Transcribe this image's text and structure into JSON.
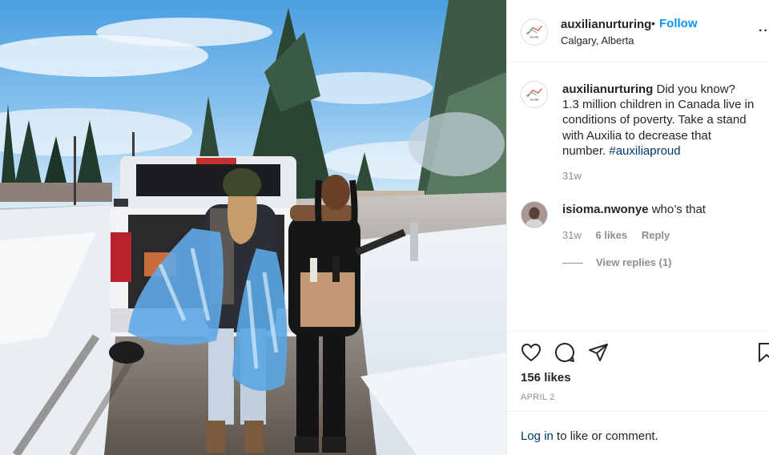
{
  "post": {
    "username": "auxilianurturing",
    "dot": "•",
    "follow_label": "Follow",
    "location": "Calgary, Alberta",
    "more_icon": "more-options-icon",
    "avatar_text": "Auxilia"
  },
  "caption": {
    "username": "auxilianurturing",
    "text": " Did you know? 1.3 million children in Canada live in conditions of poverty. Take a stand with Auxilia to decrease that number. ",
    "hashtag": "#auxiliaproud",
    "time": "31w"
  },
  "comment": {
    "username": "isioma.nwonye",
    "text": " who’s that",
    "time": "31w",
    "likes": "6 likes",
    "reply_label": "Reply",
    "view_replies": "View replies (1)"
  },
  "actions": {
    "like_icon": "heart-icon",
    "comment_icon": "comment-icon",
    "share_icon": "share-icon",
    "save_icon": "bookmark-icon",
    "likes": "156 likes",
    "date": "APRIL 2"
  },
  "login": {
    "link": "Log in",
    "text": " to like or comment."
  },
  "colors": {
    "accent": "#0095f6",
    "hashtag": "#00376b",
    "muted": "#8e8e8e",
    "text": "#262626"
  }
}
